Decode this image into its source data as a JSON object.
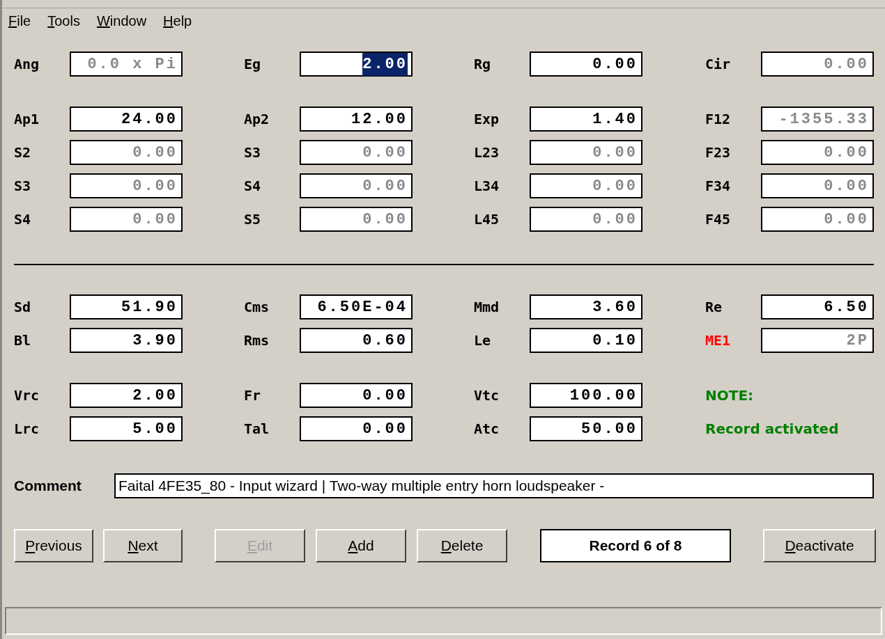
{
  "menu": [
    {
      "label": "File"
    },
    {
      "label": "Tools"
    },
    {
      "label": "Window"
    },
    {
      "label": "Help"
    }
  ],
  "upper_groups": [
    {
      "rows": [
        [
          {
            "kind": "field",
            "label": "Ang",
            "value": "0.0 x Pi",
            "disabled": true,
            "selected": false
          },
          {
            "kind": "field",
            "label": "Eg",
            "value": "2.00",
            "disabled": false,
            "selected": true
          },
          {
            "kind": "field",
            "label": "Rg",
            "value": "0.00",
            "disabled": false,
            "selected": false
          },
          {
            "kind": "field",
            "label": "Cir",
            "value": "0.00",
            "disabled": true,
            "selected": false
          }
        ]
      ]
    },
    {
      "rows": [
        [
          {
            "kind": "field",
            "label": "Ap1",
            "value": "24.00",
            "disabled": false,
            "selected": false
          },
          {
            "kind": "field",
            "label": "Ap2",
            "value": "12.00",
            "disabled": false,
            "selected": false
          },
          {
            "kind": "field",
            "label": "Exp",
            "value": "1.40",
            "disabled": false,
            "selected": false
          },
          {
            "kind": "field",
            "label": "F12",
            "value": "-1355.33",
            "disabled": true,
            "selected": false
          }
        ],
        [
          {
            "kind": "field",
            "label": "S2",
            "value": "0.00",
            "disabled": true,
            "selected": false
          },
          {
            "kind": "field",
            "label": "S3",
            "value": "0.00",
            "disabled": true,
            "selected": false
          },
          {
            "kind": "field",
            "label": "L23",
            "value": "0.00",
            "disabled": true,
            "selected": false
          },
          {
            "kind": "field",
            "label": "F23",
            "value": "0.00",
            "disabled": true,
            "selected": false
          }
        ],
        [
          {
            "kind": "field",
            "label": "S3",
            "value": "0.00",
            "disabled": true,
            "selected": false
          },
          {
            "kind": "field",
            "label": "S4",
            "value": "0.00",
            "disabled": true,
            "selected": false
          },
          {
            "kind": "field",
            "label": "L34",
            "value": "0.00",
            "disabled": true,
            "selected": false
          },
          {
            "kind": "field",
            "label": "F34",
            "value": "0.00",
            "disabled": true,
            "selected": false
          }
        ],
        [
          {
            "kind": "field",
            "label": "S4",
            "value": "0.00",
            "disabled": true,
            "selected": false
          },
          {
            "kind": "field",
            "label": "S5",
            "value": "0.00",
            "disabled": true,
            "selected": false
          },
          {
            "kind": "field",
            "label": "L45",
            "value": "0.00",
            "disabled": true,
            "selected": false
          },
          {
            "kind": "field",
            "label": "F45",
            "value": "0.00",
            "disabled": true,
            "selected": false
          }
        ]
      ]
    }
  ],
  "lower_groups": [
    {
      "rows": [
        [
          {
            "kind": "field",
            "label": "Sd",
            "value": "51.90",
            "disabled": false,
            "selected": false
          },
          {
            "kind": "field",
            "label": "Cms",
            "value": "6.50E-04",
            "disabled": false,
            "selected": false
          },
          {
            "kind": "field",
            "label": "Mmd",
            "value": "3.60",
            "disabled": false,
            "selected": false
          },
          {
            "kind": "field",
            "label": "Re",
            "value": "6.50",
            "disabled": false,
            "selected": false
          }
        ],
        [
          {
            "kind": "field",
            "label": "Bl",
            "value": "3.90",
            "disabled": false,
            "selected": false
          },
          {
            "kind": "field",
            "label": "Rms",
            "value": "0.60",
            "disabled": false,
            "selected": false
          },
          {
            "kind": "field",
            "label": "Le",
            "value": "0.10",
            "disabled": false,
            "selected": false
          },
          {
            "kind": "field",
            "label": "ME1",
            "color": "#ff0000",
            "value": "2P",
            "disabled": true,
            "selected": false
          }
        ]
      ]
    },
    {
      "rows": [
        [
          {
            "kind": "field",
            "label": "Vrc",
            "value": "2.00",
            "disabled": false,
            "selected": false
          },
          {
            "kind": "field",
            "label": "Fr",
            "value": "0.00",
            "disabled": false,
            "selected": false
          },
          {
            "kind": "field",
            "label": "Vtc",
            "value": "100.00",
            "disabled": false,
            "selected": false
          },
          {
            "kind": "note",
            "text": "NOTE:",
            "color": "#008000"
          }
        ],
        [
          {
            "kind": "field",
            "label": "Lrc",
            "value": "5.00",
            "disabled": false,
            "selected": false
          },
          {
            "kind": "field",
            "label": "Tal",
            "value": "0.00",
            "disabled": false,
            "selected": false
          },
          {
            "kind": "field",
            "label": "Atc",
            "value": "50.00",
            "disabled": false,
            "selected": false
          },
          {
            "kind": "note",
            "text": "Record activated",
            "color": "#008000"
          }
        ]
      ]
    }
  ],
  "comment": {
    "label": "Comment",
    "value": "Faital 4FE35_80 - Input wizard | Two-way multiple entry horn loudspeaker  -"
  },
  "buttons": [
    {
      "label": "Previous",
      "disabled": false
    },
    {
      "label": "Next",
      "disabled": false
    },
    {
      "label": "Edit",
      "disabled": true
    },
    {
      "label": "Add",
      "disabled": false
    },
    {
      "label": "Delete",
      "disabled": false
    }
  ],
  "record_indicator": "Record 6 of 8",
  "deactivate_button": {
    "label": "Deactivate",
    "disabled": false
  }
}
